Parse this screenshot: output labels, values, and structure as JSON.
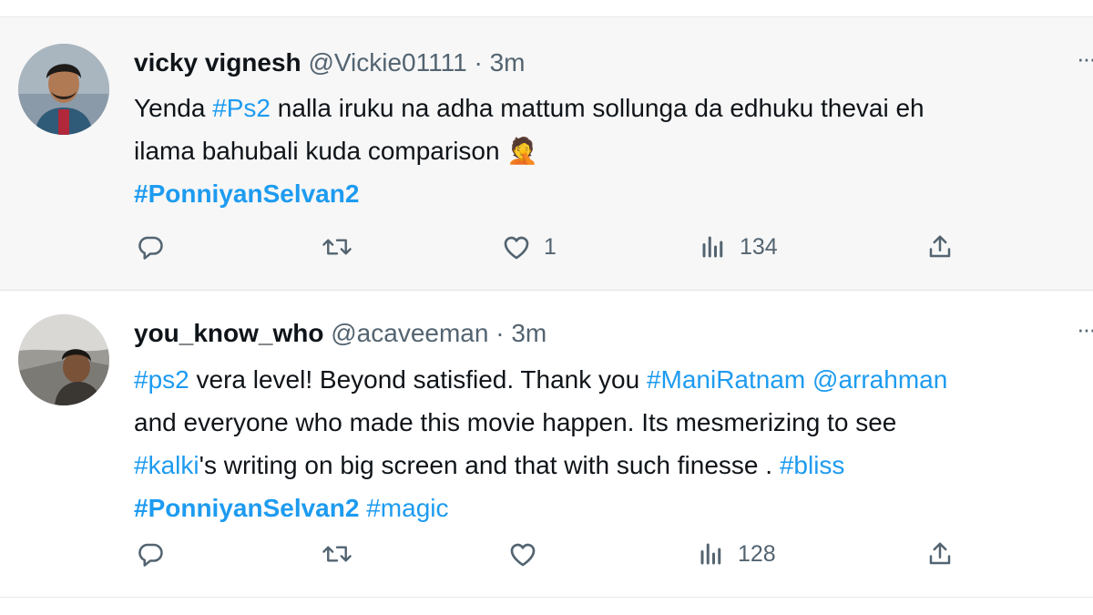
{
  "colors": {
    "link": "#1d9bf0",
    "text": "#0f1419",
    "muted": "#536471",
    "hover_bg": "#f7f7f7"
  },
  "tweets": [
    {
      "name": "vicky vignesh",
      "handle": "@Vickie01111",
      "sep": "·",
      "time": "3m",
      "more": "···",
      "lines": [
        [
          {
            "t": "Yenda "
          },
          {
            "t": "#Ps2",
            "tag": true
          },
          {
            "t": " nalla iruku na adha mattum sollunga da edhuku thevai eh"
          }
        ],
        [
          {
            "t": "ilama bahubali kuda comparison "
          },
          {
            "t": "🤦",
            "emoji": true
          }
        ],
        [
          {
            "t": "#PonniyanSelvan2",
            "tag": true,
            "bold": true
          }
        ]
      ],
      "actions": {
        "reply_icon": "reply-icon",
        "retweet_icon": "retweet-icon",
        "like_icon": "like-icon",
        "like_count": "1",
        "views_icon": "views-icon",
        "views_count": "134",
        "share_icon": "share-icon"
      }
    },
    {
      "name": "you_know_who",
      "handle": "@acaveeman",
      "sep": "·",
      "time": "3m",
      "more": "···",
      "lines": [
        [
          {
            "t": "#ps2",
            "tag": true
          },
          {
            "t": " vera level! Beyond satisfied. Thank you "
          },
          {
            "t": "#ManiRatnam",
            "tag": true
          },
          {
            "t": " "
          },
          {
            "t": "@arrahman",
            "tag": true
          }
        ],
        [
          {
            "t": "and everyone who made this movie happen. Its mesmerizing to see"
          }
        ],
        [
          {
            "t": "#kalki",
            "tag": true
          },
          {
            "t": "'s writing on big screen and that with such finesse . "
          },
          {
            "t": "#bliss",
            "tag": true
          }
        ],
        [
          {
            "t": "#PonniyanSelvan2",
            "tag": true,
            "bold": true
          },
          {
            "t": " "
          },
          {
            "t": "#magic",
            "tag": true
          }
        ]
      ],
      "actions": {
        "reply_icon": "reply-icon",
        "retweet_icon": "retweet-icon",
        "like_icon": "like-icon",
        "like_count": "",
        "views_icon": "views-icon",
        "views_count": "128",
        "share_icon": "share-icon"
      }
    }
  ]
}
